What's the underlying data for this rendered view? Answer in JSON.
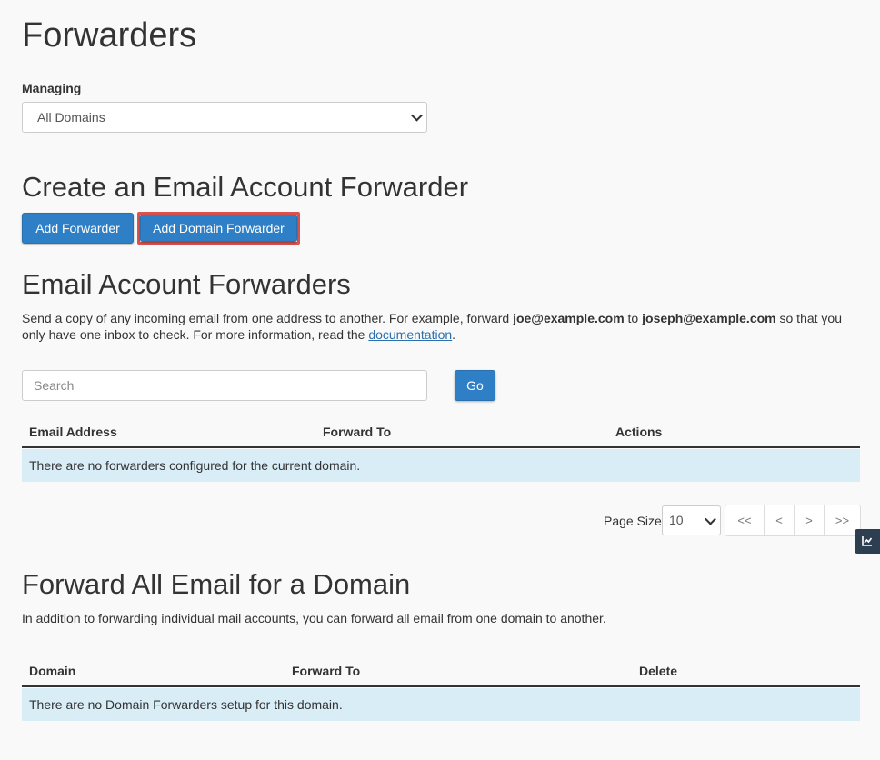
{
  "page": {
    "title": "Forwarders"
  },
  "managing": {
    "label": "Managing",
    "selected": "All Domains"
  },
  "create_section": {
    "heading": "Create an Email Account Forwarder",
    "add_forwarder_label": "Add Forwarder",
    "add_domain_forwarder_label": "Add Domain Forwarder"
  },
  "account_forwarders": {
    "heading": "Email Account Forwarders",
    "description_part1": "Send a copy of any incoming email from one address to another. For example, forward ",
    "example_from": "joe@example.com",
    "description_to": " to ",
    "example_to": "joseph@example.com",
    "description_part2": " so that you only have one inbox to check. For more information, read the ",
    "doc_link": "documentation",
    "description_end": ".",
    "search_placeholder": "Search",
    "go_label": "Go",
    "columns": [
      "Email Address",
      "Forward To",
      "Actions"
    ],
    "empty_message": "There are no forwarders configured for the current domain.",
    "page_size_label": "Page Size",
    "page_size_value": "10",
    "pager": [
      "<<",
      "<",
      ">",
      ">>"
    ]
  },
  "domain_forwarders": {
    "heading": "Forward All Email for a Domain",
    "description": "In addition to forwarding individual mail accounts, you can forward all email from one domain to another.",
    "columns": [
      "Domain",
      "Forward To",
      "Delete"
    ],
    "empty_message": "There are no Domain Forwarders setup for this domain."
  },
  "icons": {
    "side_tab": "chart-line-icon"
  },
  "colors": {
    "primary": "#2e7fc5",
    "highlight": "#d9534f",
    "empty_row": "#d9edf7",
    "side_tab": "#2d3e50"
  }
}
